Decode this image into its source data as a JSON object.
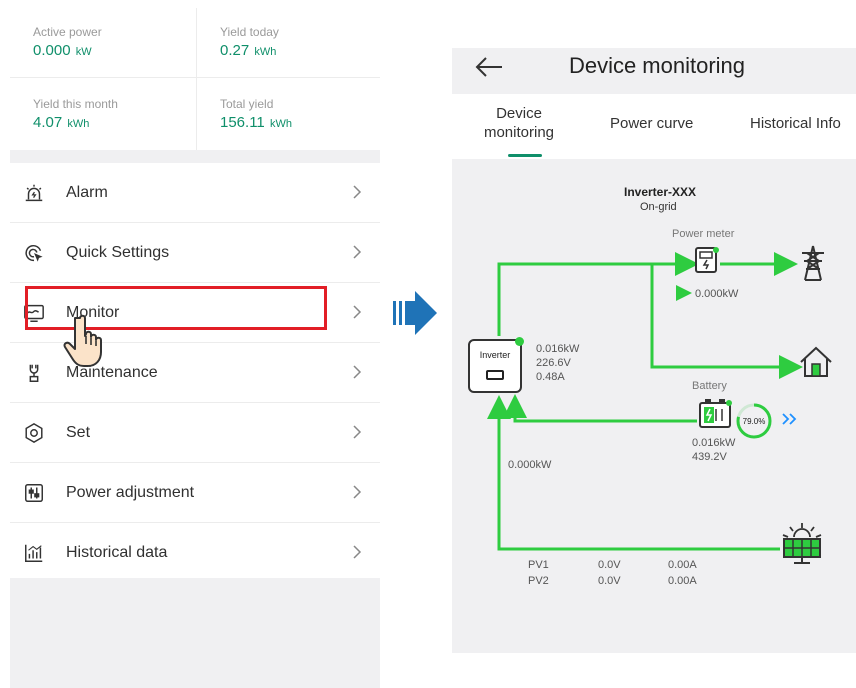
{
  "stats": [
    {
      "label": "Active power",
      "value": "0.000",
      "unit": "kW"
    },
    {
      "label": "Yield today",
      "value": "0.27",
      "unit": "kWh"
    },
    {
      "label": "Yield this month",
      "value": "4.07",
      "unit": "kWh"
    },
    {
      "label": "Total yield",
      "value": "156.11",
      "unit": "kWh"
    }
  ],
  "menu": [
    {
      "label": "Alarm",
      "icon": "alarm-icon"
    },
    {
      "label": "Quick Settings",
      "icon": "quick-settings-icon"
    },
    {
      "label": "Monitor",
      "icon": "monitor-icon"
    },
    {
      "label": "Maintenance",
      "icon": "maintenance-icon"
    },
    {
      "label": "Set",
      "icon": "settings-hexagon-icon"
    },
    {
      "label": "Power adjustment",
      "icon": "power-adjustment-icon"
    },
    {
      "label": "Historical data",
      "icon": "historical-data-icon"
    }
  ],
  "highlight_item": "Monitor",
  "colors": {
    "accent": "#0f8f6a",
    "flow": "#2ecc40",
    "highlight": "#e21e26",
    "arrow": "#1f73b7"
  },
  "right": {
    "title": "Device monitoring",
    "tabs": [
      {
        "line1": "Device",
        "line2": "monitoring",
        "active": true
      },
      {
        "line1": "Power curve",
        "line2": ""
      },
      {
        "line1": "Historical Info",
        "line2": ""
      }
    ],
    "inverter_name": "Inverter-XXX",
    "inverter_status": "On-grid",
    "inverter_box_label": "Inverter",
    "inverter_power": "0.016kW",
    "inverter_voltage": "226.6V",
    "inverter_current": "0.48A",
    "meter_label": "Power meter",
    "meter_power": "0.000kW",
    "battery_label": "Battery",
    "battery_soc": "79.0%",
    "battery_power": "0.016kW",
    "battery_voltage": "439.2V",
    "pv_power": "0.000kW",
    "pv_rows": [
      {
        "name": "PV1",
        "voltage": "0.0V",
        "current": "0.00A"
      },
      {
        "name": "PV2",
        "voltage": "0.0V",
        "current": "0.00A"
      }
    ]
  }
}
